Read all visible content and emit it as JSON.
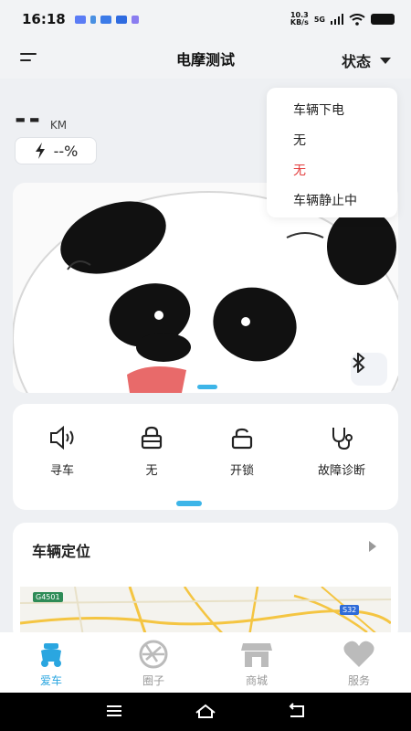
{
  "status_bar": {
    "time": "16:18",
    "net_speed_value": "10.3",
    "net_speed_unit": "KB/s",
    "signal": "5G"
  },
  "header": {
    "title": "电摩测试",
    "status_label": "状态"
  },
  "vehicle": {
    "mileage": "--",
    "mileage_unit": "KM",
    "battery": "--%"
  },
  "status_menu": {
    "items": [
      {
        "label": "车辆下电",
        "color": "#222222"
      },
      {
        "label": "无",
        "color": "#222222"
      },
      {
        "label": "无",
        "color": "#e33b3b"
      },
      {
        "label": "车辆静止中",
        "color": "#222222"
      }
    ]
  },
  "quick_actions": [
    {
      "label": "寻车",
      "icon": "speaker-icon"
    },
    {
      "label": "无",
      "icon": "lock-icon"
    },
    {
      "label": "开锁",
      "icon": "unlock-icon"
    },
    {
      "label": "故障诊断",
      "icon": "stethoscope-icon"
    }
  ],
  "location": {
    "title": "车辆定位",
    "road_signs": [
      "G4501",
      "S32"
    ]
  },
  "tabs": [
    {
      "label": "爱车",
      "icon": "scooter-icon",
      "active": true
    },
    {
      "label": "圈子",
      "icon": "aperture-icon",
      "active": false
    },
    {
      "label": "商城",
      "icon": "store-icon",
      "active": false
    },
    {
      "label": "服务",
      "icon": "heart-icon",
      "active": false
    }
  ],
  "colors": {
    "accent": "#2aa6e0",
    "alert": "#e33b3b"
  }
}
